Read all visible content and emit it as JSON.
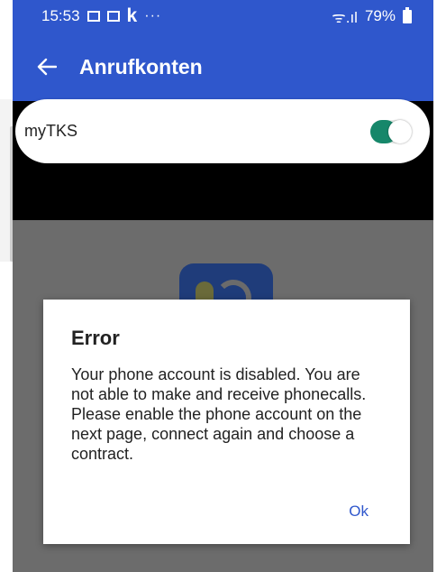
{
  "status_bar": {
    "time": "15:53",
    "app_icon_letter": "k",
    "more_dots": "···",
    "signal_text": "ᯤ.ıl",
    "battery": "79%"
  },
  "app_bar": {
    "title": "Anrufkonten",
    "back_icon": "arrow-left-icon",
    "background_color": "#2f57cc"
  },
  "account": {
    "name": "myTKS",
    "enabled": true,
    "toggle_color": "#16876a"
  },
  "dialog": {
    "title": "Error",
    "message": "Your phone account is disabled. You are not able to make and receive phonecalls. Please enable the phone account on the next page, connect again and choose a contract.",
    "ok_label": "Ok",
    "accent_color": "#2f57cc"
  }
}
